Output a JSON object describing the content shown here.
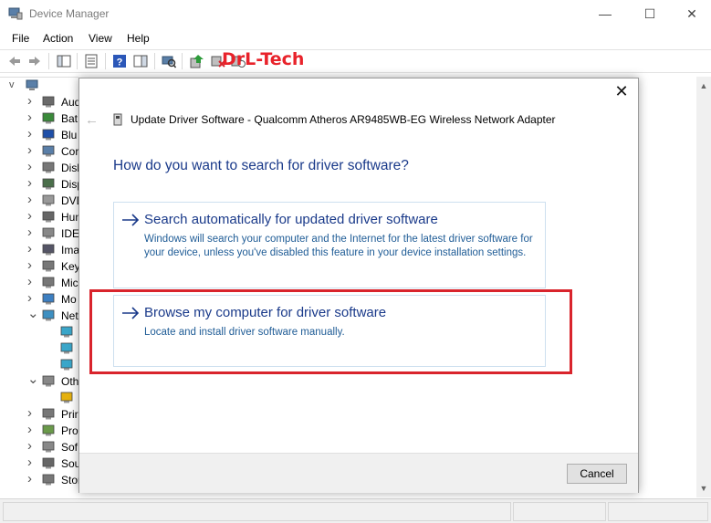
{
  "window": {
    "title": "Device Manager",
    "minimize_glyph": "—",
    "maximize_glyph": "☐",
    "close_glyph": "✕"
  },
  "menu": [
    "File",
    "Action",
    "View",
    "Help"
  ],
  "watermark": "DrL-Tech",
  "tree": {
    "items": [
      {
        "chev": ">",
        "label": "Aud",
        "icon": "audio-icon"
      },
      {
        "chev": ">",
        "label": "Bat",
        "icon": "battery-icon"
      },
      {
        "chev": ">",
        "label": "Blu",
        "icon": "bluetooth-icon"
      },
      {
        "chev": ">",
        "label": "Cor",
        "icon": "computer-icon"
      },
      {
        "chev": ">",
        "label": "Disl",
        "icon": "disk-drive-icon"
      },
      {
        "chev": ">",
        "label": "Disp",
        "icon": "display-adapter-icon"
      },
      {
        "chev": ">",
        "label": "DVD",
        "icon": "dvd-icon"
      },
      {
        "chev": ">",
        "label": "Hun",
        "icon": "hid-icon"
      },
      {
        "chev": ">",
        "label": "IDE",
        "icon": "ide-icon"
      },
      {
        "chev": ">",
        "label": "Ima",
        "icon": "imaging-icon"
      },
      {
        "chev": ">",
        "label": "Key",
        "icon": "keyboard-icon"
      },
      {
        "chev": ">",
        "label": "Mic",
        "icon": "mouse-icon"
      },
      {
        "chev": ">",
        "label": "Mo",
        "icon": "monitor-icon"
      },
      {
        "chev": "v",
        "label": "Net",
        "icon": "network-adapter-icon"
      },
      {
        "chev": "",
        "label": "",
        "icon": "network-device-icon"
      },
      {
        "chev": "",
        "label": "",
        "icon": "network-device-icon"
      },
      {
        "chev": "",
        "label": "",
        "icon": "network-device-icon"
      },
      {
        "chev": "v",
        "label": "Oth",
        "icon": "other-devices-icon"
      },
      {
        "chev": "",
        "label": "",
        "icon": "warning-device-icon"
      },
      {
        "chev": ">",
        "label": "Prir",
        "icon": "print-queue-icon"
      },
      {
        "chev": ">",
        "label": "Pro",
        "icon": "processor-icon"
      },
      {
        "chev": ">",
        "label": "Sof",
        "icon": "software-device-icon"
      },
      {
        "chev": ">",
        "label": "Sou",
        "icon": "sound-icon"
      },
      {
        "chev": ">",
        "label": "Storage controllers",
        "icon": "storage-icon"
      }
    ]
  },
  "dialog": {
    "title": "Update Driver Software - Qualcomm Atheros AR9485WB-EG Wireless Network Adapter",
    "heading": "How do you want to search for driver software?",
    "options": [
      {
        "title": "Search automatically for updated driver software",
        "description": "Windows will search your computer and the Internet for the latest driver software for your device, unless you've disabled this feature in your device installation settings."
      },
      {
        "title": "Browse my computer for driver software",
        "description": "Locate and install driver software manually."
      }
    ],
    "cancel_label": "Cancel",
    "close_glyph": "✕",
    "back_glyph": "←"
  },
  "colors": {
    "link_blue": "#1a3a8a",
    "desc_blue": "#1f5c96",
    "highlight_red": "#d9242c",
    "watermark_red": "#e8222a"
  }
}
